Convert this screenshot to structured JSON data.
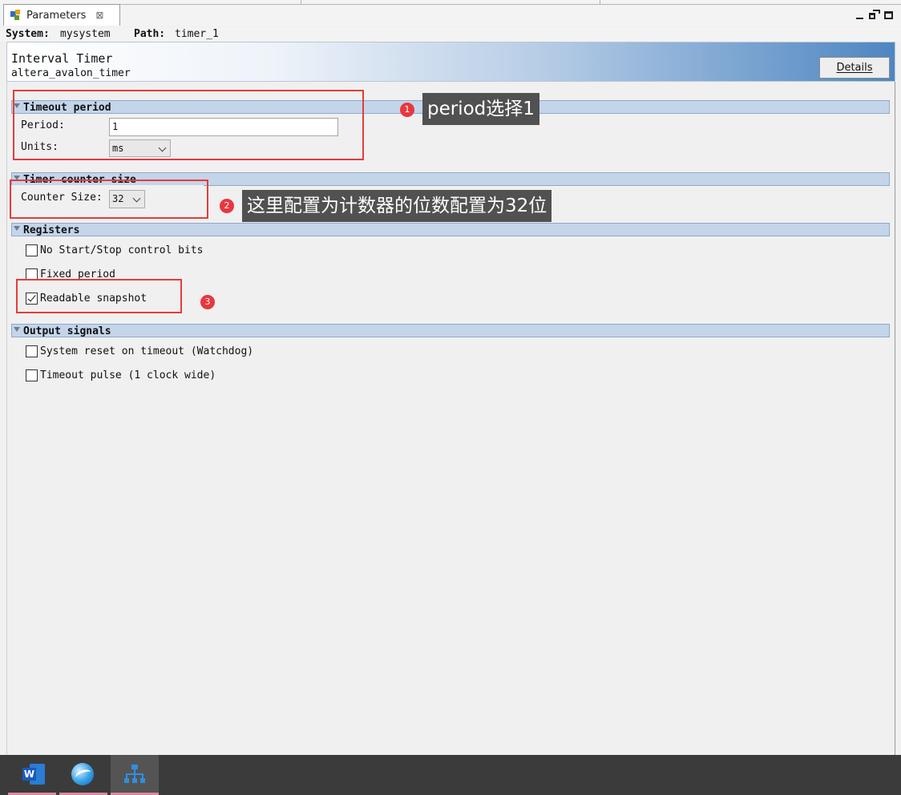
{
  "tab": {
    "label": "Parameters",
    "close_glyph": "⊠",
    "icon": "parameters-icon"
  },
  "pathbar": {
    "system_label": "System:",
    "system_value": "mysystem",
    "path_label": "Path:",
    "path_value": "timer_1"
  },
  "header": {
    "title": "Interval Timer",
    "subtitle": "altera_avalon_timer",
    "details_label": "Details"
  },
  "sections": {
    "timeout": {
      "title": "Timeout period",
      "period_label": "Period:",
      "period_value": "1",
      "units_label": "Units:",
      "units_value": "ms"
    },
    "counter": {
      "title": "Timer counter size",
      "size_label": "Counter Size:",
      "size_value": "32"
    },
    "registers": {
      "title": "Registers",
      "items": [
        {
          "label": "No Start/Stop control bits",
          "checked": false
        },
        {
          "label": "Fixed period",
          "checked": false
        },
        {
          "label": "Readable snapshot",
          "checked": true
        }
      ]
    },
    "output": {
      "title": "Output signals",
      "items": [
        {
          "label": "System reset on timeout (Watchdog)",
          "checked": false
        },
        {
          "label": "Timeout pulse (1 clock wide)",
          "checked": false
        }
      ]
    }
  },
  "annotations": [
    {
      "badge": "1",
      "text": "period选择1"
    },
    {
      "badge": "2",
      "text": "这里配置为计数器的位数配置为32位"
    },
    {
      "badge": "3",
      "text": ""
    }
  ],
  "colors": {
    "annotation_red": "#e63b3b",
    "section_bar": "#c4d5ea",
    "callout_bg": "#515151",
    "taskbar": "#3b3b3b"
  },
  "taskbar": {
    "items": [
      {
        "icon": "word-icon",
        "active": false
      },
      {
        "icon": "browser-globe-icon",
        "active": false
      },
      {
        "icon": "network-tool-icon",
        "active": true
      }
    ]
  }
}
